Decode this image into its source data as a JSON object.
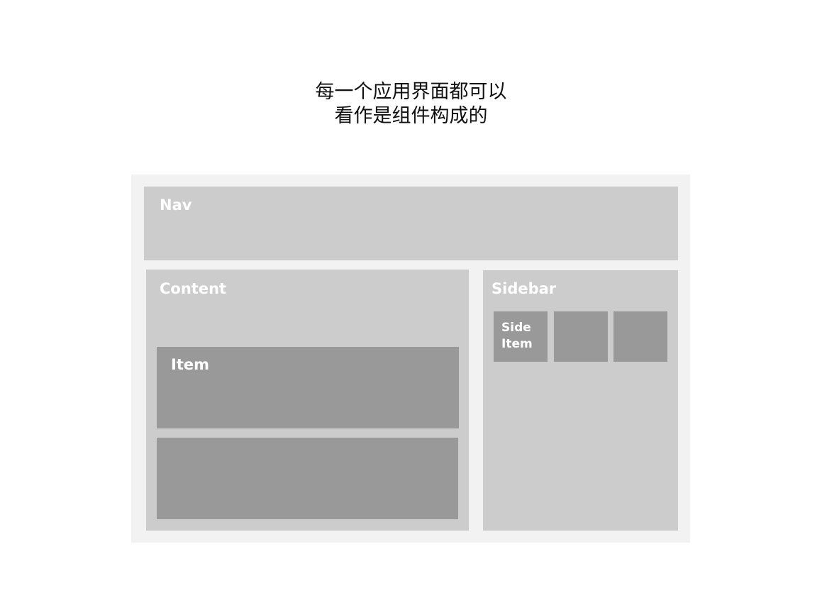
{
  "title": {
    "line1": "每一个应用界面都可以",
    "line2": "看作是组件构成的"
  },
  "diagram": {
    "nav": {
      "label": "Nav"
    },
    "content": {
      "label": "Content",
      "items": [
        {
          "label": "Item"
        },
        {
          "label": ""
        }
      ]
    },
    "sidebar": {
      "label": "Sidebar",
      "items": [
        {
          "label_line1": "Side",
          "label_line2": "Item"
        },
        {
          "label_line1": "",
          "label_line2": ""
        },
        {
          "label_line1": "",
          "label_line2": ""
        }
      ]
    }
  },
  "colors": {
    "frame": "#f2f2f2",
    "component": "#cccccc",
    "sub_component": "#999999",
    "label": "#ffffff",
    "title": "#111111"
  }
}
